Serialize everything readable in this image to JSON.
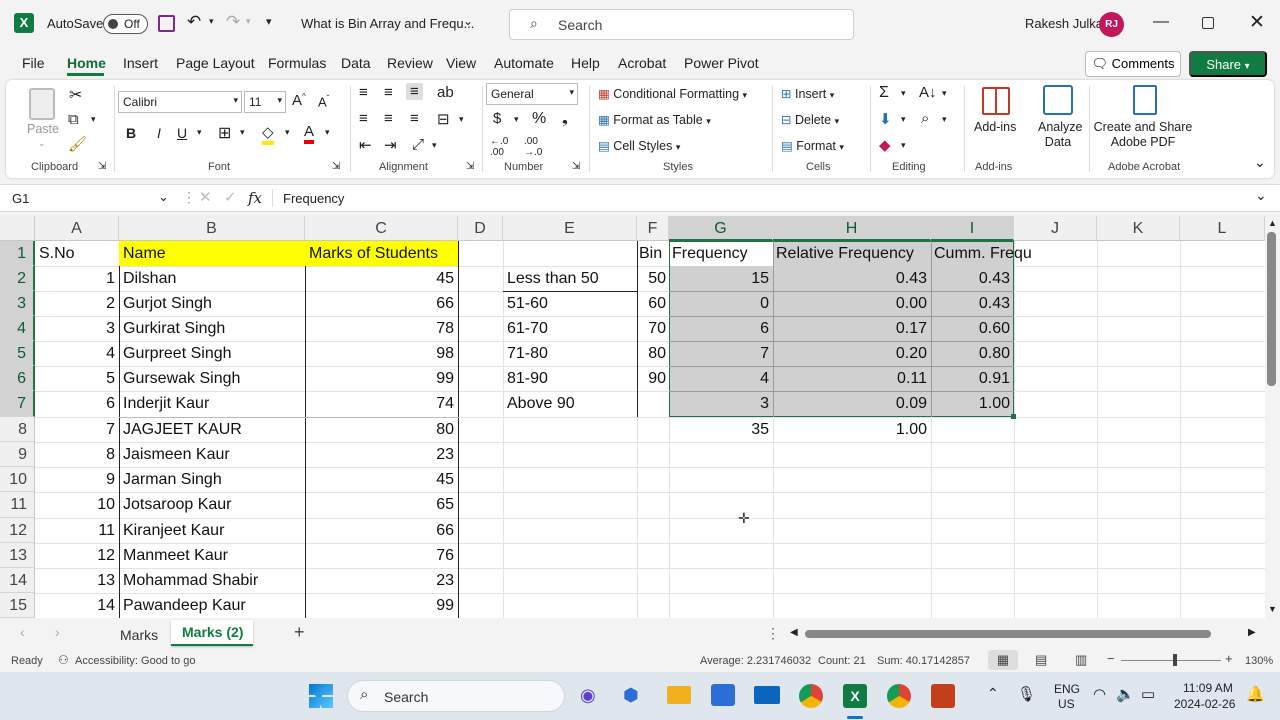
{
  "titlebar": {
    "autosave_label": "AutoSave",
    "autosave_state": "Off",
    "doc_title": "What is Bin Array and Frequ...",
    "search_placeholder": "Search",
    "user_name": "Rakesh Julka",
    "user_initials": "RJ"
  },
  "menu": {
    "items": [
      "File",
      "Home",
      "Insert",
      "Page Layout",
      "Formulas",
      "Data",
      "Review",
      "View",
      "Automate",
      "Help",
      "Acrobat",
      "Power Pivot"
    ],
    "comments_label": "Comments",
    "share_label": "Share"
  },
  "ribbon": {
    "clipboard": {
      "paste": "Paste",
      "label": "Clipboard"
    },
    "font": {
      "name": "Calibri",
      "size": "11",
      "label": "Font"
    },
    "alignment": {
      "label": "Alignment"
    },
    "number": {
      "format": "General",
      "label": "Number"
    },
    "styles": {
      "conditional": "Conditional Formatting",
      "table": "Format as Table",
      "cell_styles": "Cell Styles",
      "label": "Styles"
    },
    "cells": {
      "insert": "Insert",
      "delete": "Delete",
      "format": "Format",
      "label": "Cells"
    },
    "editing": {
      "label": "Editing"
    },
    "addins": {
      "addins": "Add-ins",
      "analyze": "Analyze Data",
      "label": "Add-ins"
    },
    "acrobat": {
      "create": "Create and Share Adobe PDF",
      "label": "Adobe Acrobat"
    }
  },
  "formula_bar": {
    "name_box": "G1",
    "fx": "fx",
    "content": "Frequency"
  },
  "grid": {
    "columns": [
      "A",
      "B",
      "C",
      "D",
      "E",
      "F",
      "G",
      "H",
      "I",
      "J",
      "K",
      "L"
    ],
    "rows": [
      "1",
      "2",
      "3",
      "4",
      "5",
      "6",
      "7",
      "8",
      "9",
      "10",
      "11",
      "12",
      "13",
      "14",
      "15"
    ],
    "header": {
      "sno": "S.No",
      "name": "Name",
      "marks": "Marks of Students",
      "bin": "Bin",
      "freq": "Frequency",
      "relfreq": "Relative Frequency",
      "cumm": "Cumm. Frequ"
    },
    "students": [
      {
        "sno": "1",
        "name": "Dilshan",
        "marks": "45"
      },
      {
        "sno": "2",
        "name": "Gurjot Singh",
        "marks": "66"
      },
      {
        "sno": "3",
        "name": "Gurkirat Singh",
        "marks": "78"
      },
      {
        "sno": "4",
        "name": "Gurpreet Singh",
        "marks": "98"
      },
      {
        "sno": "5",
        "name": "Gursewak Singh",
        "marks": "99"
      },
      {
        "sno": "6",
        "name": "Inderjit Kaur",
        "marks": "74"
      },
      {
        "sno": "7",
        "name": "JAGJEET KAUR",
        "marks": "80"
      },
      {
        "sno": "8",
        "name": "Jaismeen Kaur",
        "marks": "23"
      },
      {
        "sno": "9",
        "name": "Jarman Singh",
        "marks": "45"
      },
      {
        "sno": "10",
        "name": "Jotsaroop Kaur",
        "marks": "65"
      },
      {
        "sno": "11",
        "name": "Kiranjeet Kaur",
        "marks": "66"
      },
      {
        "sno": "12",
        "name": "Manmeet Kaur",
        "marks": "76"
      },
      {
        "sno": "13",
        "name": "Mohammad Shabir",
        "marks": "23"
      },
      {
        "sno": "14",
        "name": "Pawandeep Kaur",
        "marks": "99"
      }
    ],
    "bins": [
      {
        "label": "Less than 50",
        "bin": "50",
        "freq": "15",
        "rel": "0.43",
        "cum": "0.43"
      },
      {
        "label": "51-60",
        "bin": "60",
        "freq": "0",
        "rel": "0.00",
        "cum": "0.43"
      },
      {
        "label": "61-70",
        "bin": "70",
        "freq": "6",
        "rel": "0.17",
        "cum": "0.60"
      },
      {
        "label": "71-80",
        "bin": "80",
        "freq": "7",
        "rel": "0.20",
        "cum": "0.80"
      },
      {
        "label": "81-90",
        "bin": "90",
        "freq": "4",
        "rel": "0.11",
        "cum": "0.91"
      },
      {
        "label": "Above 90",
        "bin": "",
        "freq": "3",
        "rel": "0.09",
        "cum": "1.00"
      }
    ],
    "totals": {
      "freq": "35",
      "rel": "1.00"
    }
  },
  "sheets": {
    "tabs": [
      "Marks",
      "Marks (2)"
    ],
    "active": "Marks (2)",
    "add": "+"
  },
  "status": {
    "ready": "Ready",
    "accessibility": "Accessibility: Good to go",
    "average": "Average: 2.231746032",
    "count": "Count: 21",
    "sum": "Sum: 40.17142857",
    "zoom": "130%"
  },
  "taskbar": {
    "search": "Search",
    "lang1": "ENG",
    "lang2": "US",
    "time": "11:09 AM",
    "date": "2024-02-26"
  },
  "colors": {
    "excel_green": "#107c41",
    "header_yellow": "#ffff00",
    "selection_gray": "#d0d0d0"
  }
}
